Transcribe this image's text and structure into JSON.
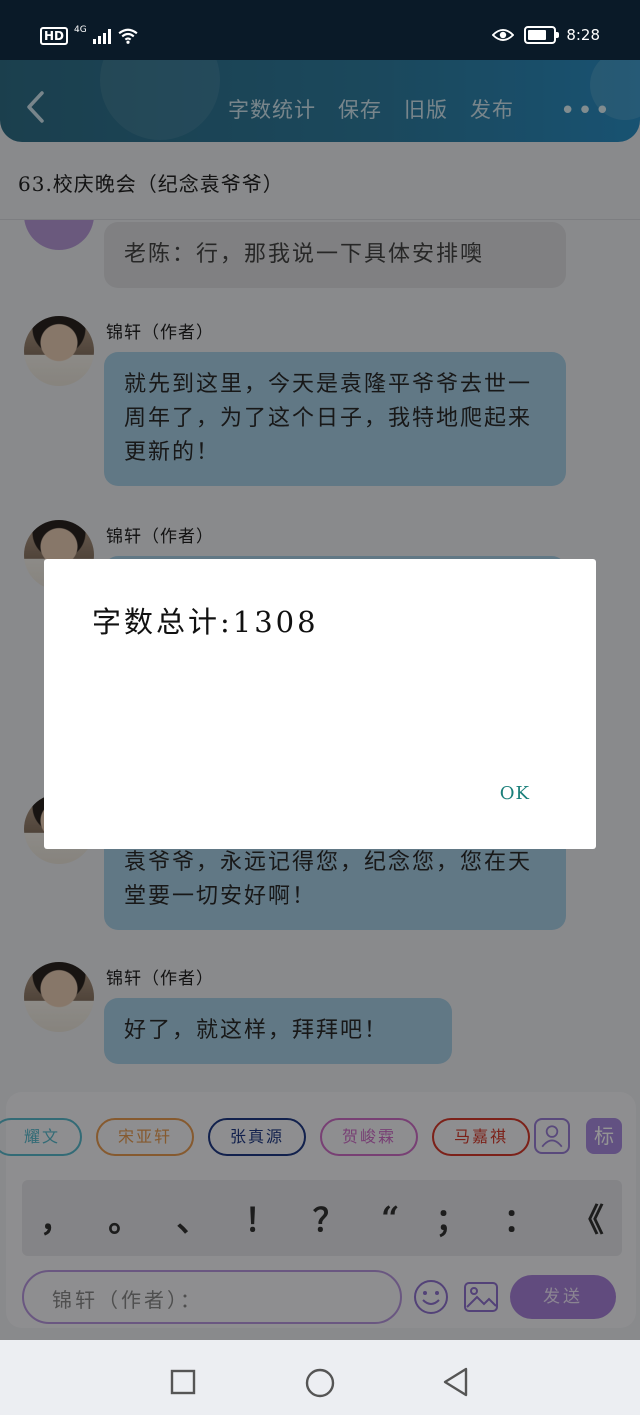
{
  "status_bar": {
    "time": "8:28",
    "hd": "HD",
    "network": "4G"
  },
  "header": {
    "actions": [
      "字数统计",
      "保存",
      "旧版",
      "发布"
    ],
    "more": "•••"
  },
  "chapter": {
    "title": "63.校庆晚会（纪念袁爷爷）"
  },
  "messages": [
    {
      "sender": "",
      "text": "老陈：行，那我说一下具体安排噢"
    },
    {
      "sender": "锦轩（作者）",
      "text": "就先到这里，今天是袁隆平爷爷去世一周年了，为了这个日子，我特地爬起来更新的！"
    },
    {
      "sender": "锦轩（作者）",
      "text": ""
    },
    {
      "sender": "",
      "text": "袁爷爷，永远记得您，纪念您，您在天堂要一切安好啊！"
    },
    {
      "sender": "锦轩（作者）",
      "text": "好了，就这样，拜拜吧！"
    }
  ],
  "roles": [
    "耀文",
    "宋亚轩",
    "张真源",
    "贺峻霖",
    "马嘉祺"
  ],
  "tag_button": "标",
  "punctuation": [
    "，",
    "。",
    "、",
    "！",
    "？",
    "“",
    "；",
    "：",
    "《"
  ],
  "input": {
    "placeholder": "锦轩（作者）："
  },
  "send_label": "发送",
  "dialog": {
    "message": "字数总计:1308",
    "ok_label": "OK"
  },
  "colors": {
    "header": "#2f7da0",
    "bubble": "#a8cfe6",
    "accent": "#a781d9",
    "ok": "#1a7f7a"
  }
}
